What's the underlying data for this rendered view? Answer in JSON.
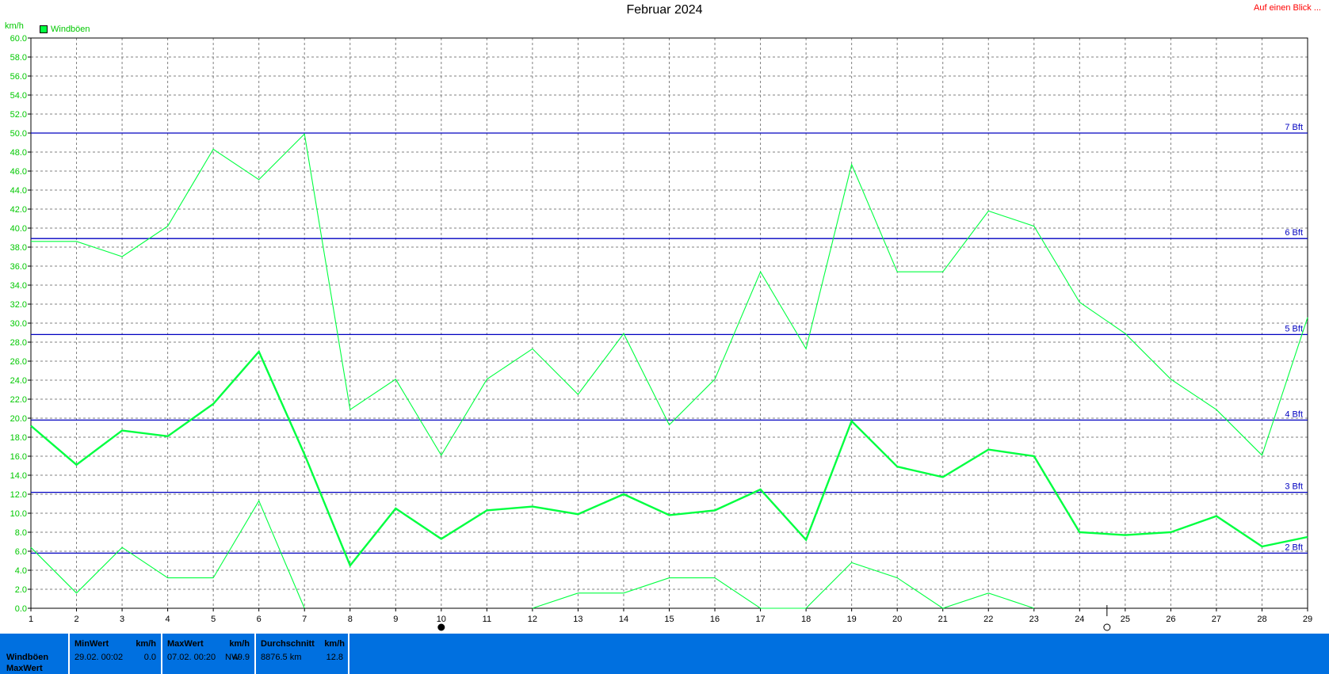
{
  "header": {
    "title": "Februar 2024",
    "quick_link": "Auf einen Blick ..."
  },
  "colors": {
    "series": "#00ff40",
    "series_text": "#00c800",
    "beaufort": "#0000c0",
    "grid": "#808080",
    "stats_bg": "#0070e0"
  },
  "chart_data": {
    "type": "line",
    "title": "Februar 2024",
    "ylabel": "km/h",
    "legend": [
      "Windböen"
    ],
    "legend_position": "top-left",
    "grid": true,
    "xlim": [
      1,
      29
    ],
    "ylim": [
      0,
      60
    ],
    "x_ticks": [
      1,
      2,
      3,
      4,
      5,
      6,
      7,
      8,
      9,
      10,
      11,
      12,
      13,
      14,
      15,
      16,
      17,
      18,
      19,
      20,
      21,
      22,
      23,
      24,
      25,
      26,
      27,
      28,
      29
    ],
    "y_ticks": [
      "0.0",
      "2.0",
      "4.0",
      "6.0",
      "8.0",
      "10.0",
      "12.0",
      "14.0",
      "16.0",
      "18.0",
      "20.0",
      "22.0",
      "24.0",
      "26.0",
      "28.0",
      "30.0",
      "32.0",
      "34.0",
      "36.0",
      "38.0",
      "40.0",
      "42.0",
      "44.0",
      "46.0",
      "48.0",
      "50.0",
      "52.0",
      "54.0",
      "56.0",
      "58.0",
      "60.0"
    ],
    "series": [
      {
        "name": "Windböen",
        "style": "average",
        "points": [
          [
            1,
            19.2
          ],
          [
            2,
            15.1
          ],
          [
            3,
            18.7
          ],
          [
            4,
            18.1
          ],
          [
            5,
            21.5
          ],
          [
            6,
            27.0
          ],
          [
            7,
            16.2
          ],
          [
            8,
            4.5
          ],
          [
            9,
            10.5
          ],
          [
            10,
            7.3
          ],
          [
            11,
            10.3
          ],
          [
            12,
            10.7
          ],
          [
            13,
            9.9
          ],
          [
            14,
            12.0
          ],
          [
            15,
            9.8
          ],
          [
            16,
            10.3
          ],
          [
            17,
            12.5
          ],
          [
            18,
            7.2
          ],
          [
            19,
            19.7
          ],
          [
            20,
            14.9
          ],
          [
            21,
            13.8
          ],
          [
            22,
            16.7
          ],
          [
            23,
            16.0
          ],
          [
            24,
            8.0
          ],
          [
            25,
            7.7
          ],
          [
            26,
            8.0
          ],
          [
            27,
            9.7
          ],
          [
            28,
            6.5
          ],
          [
            29,
            7.5
          ]
        ]
      },
      {
        "name": "Windböen MaxWert",
        "style": "max",
        "points": [
          [
            1,
            38.6
          ],
          [
            2,
            38.6
          ],
          [
            3,
            37.0
          ],
          [
            4,
            40.2
          ],
          [
            5,
            48.3
          ],
          [
            6,
            45.1
          ],
          [
            7,
            49.9
          ],
          [
            8,
            20.9
          ],
          [
            9,
            24.1
          ],
          [
            10,
            16.1
          ],
          [
            11,
            24.1
          ],
          [
            12,
            27.3
          ],
          [
            13,
            22.5
          ],
          [
            14,
            28.9
          ],
          [
            15,
            19.3
          ],
          [
            16,
            24.1
          ],
          [
            17,
            35.4
          ],
          [
            18,
            27.3
          ],
          [
            19,
            46.7
          ],
          [
            20,
            35.4
          ],
          [
            21,
            35.4
          ],
          [
            22,
            41.8
          ],
          [
            23,
            40.2
          ],
          [
            24,
            32.2
          ],
          [
            25,
            28.9
          ],
          [
            26,
            24.1
          ],
          [
            27,
            20.9
          ],
          [
            28,
            16.1
          ],
          [
            29,
            30.6
          ]
        ]
      },
      {
        "name": "Windböen MinWert",
        "style": "min",
        "points": [
          [
            1,
            6.4
          ],
          [
            2,
            1.6
          ],
          [
            3,
            6.4
          ],
          [
            4,
            3.2
          ],
          [
            5,
            3.2
          ],
          [
            6,
            11.3
          ],
          [
            7,
            0.0
          ],
          [
            null,
            null
          ],
          [
            12,
            0.0
          ],
          [
            13,
            1.6
          ],
          [
            14,
            1.6
          ],
          [
            15,
            3.2
          ],
          [
            16,
            3.2
          ],
          [
            17,
            0.0
          ],
          [
            18,
            0.0
          ],
          [
            19,
            4.8
          ],
          [
            20,
            3.2
          ],
          [
            21,
            0.0
          ],
          [
            22,
            1.6
          ],
          [
            23,
            0.0
          ]
        ]
      }
    ],
    "reference_lines": [
      {
        "label": "2 Bft",
        "value": 5.8
      },
      {
        "label": "3 Bft",
        "value": 12.2
      },
      {
        "label": "4 Bft",
        "value": 19.8
      },
      {
        "label": "5 Bft",
        "value": 28.8
      },
      {
        "label": "6 Bft",
        "value": 38.9
      },
      {
        "label": "7 Bft",
        "value": 50.0
      }
    ],
    "markers": [
      {
        "symbol": "full-moon-icon",
        "x": 10
      },
      {
        "symbol": "new-moon-icon",
        "x": 24.6
      }
    ]
  },
  "stats": {
    "row_label_1": "Windböen",
    "row_label_2": "MaxWert",
    "min": {
      "header": "MinWert",
      "unit": "km/h",
      "time": "29.02.  00:02",
      "value": "0.0"
    },
    "max": {
      "header": "MaxWert",
      "unit": "km/h",
      "time": "07.02.  00:20",
      "direction": "NW",
      "value": "49.9"
    },
    "avg": {
      "header": "Durchschnitt",
      "unit": "km/h",
      "distance": "8876.5 km",
      "value": "12.8"
    }
  }
}
